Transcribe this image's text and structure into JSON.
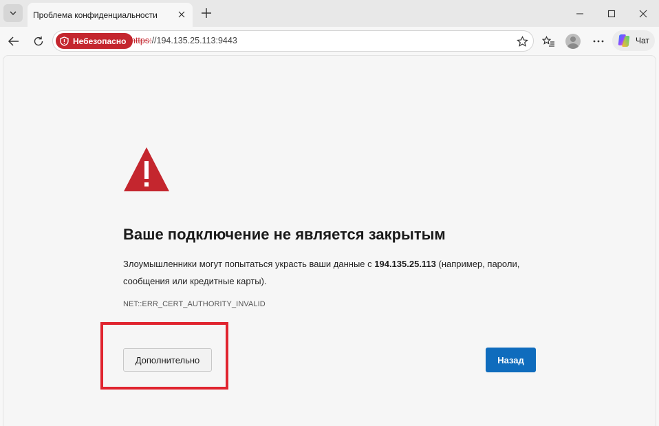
{
  "tab": {
    "title": "Проблема конфиденциальности"
  },
  "address_bar": {
    "security_badge": "Небезопасно",
    "url_scheme": "https:",
    "url_rest": "//194.135.25.113:9443"
  },
  "toolbar": {
    "copilot_label": "Чат"
  },
  "error_page": {
    "heading": "Ваше подключение не является закрытым",
    "description_before": "Злоумышленники могут попытаться украсть ваши данные с ",
    "description_host": "194.135.25.113",
    "description_after": " (например, пароли, сообщения или кредитные карты).",
    "error_code": "NET::ERR_CERT_AUTHORITY_INVALID",
    "advanced_button": "Дополнительно",
    "back_button": "Назад"
  },
  "colors": {
    "danger": "#c4262e",
    "primary": "#0f6cbd",
    "highlight": "#e0242f"
  }
}
